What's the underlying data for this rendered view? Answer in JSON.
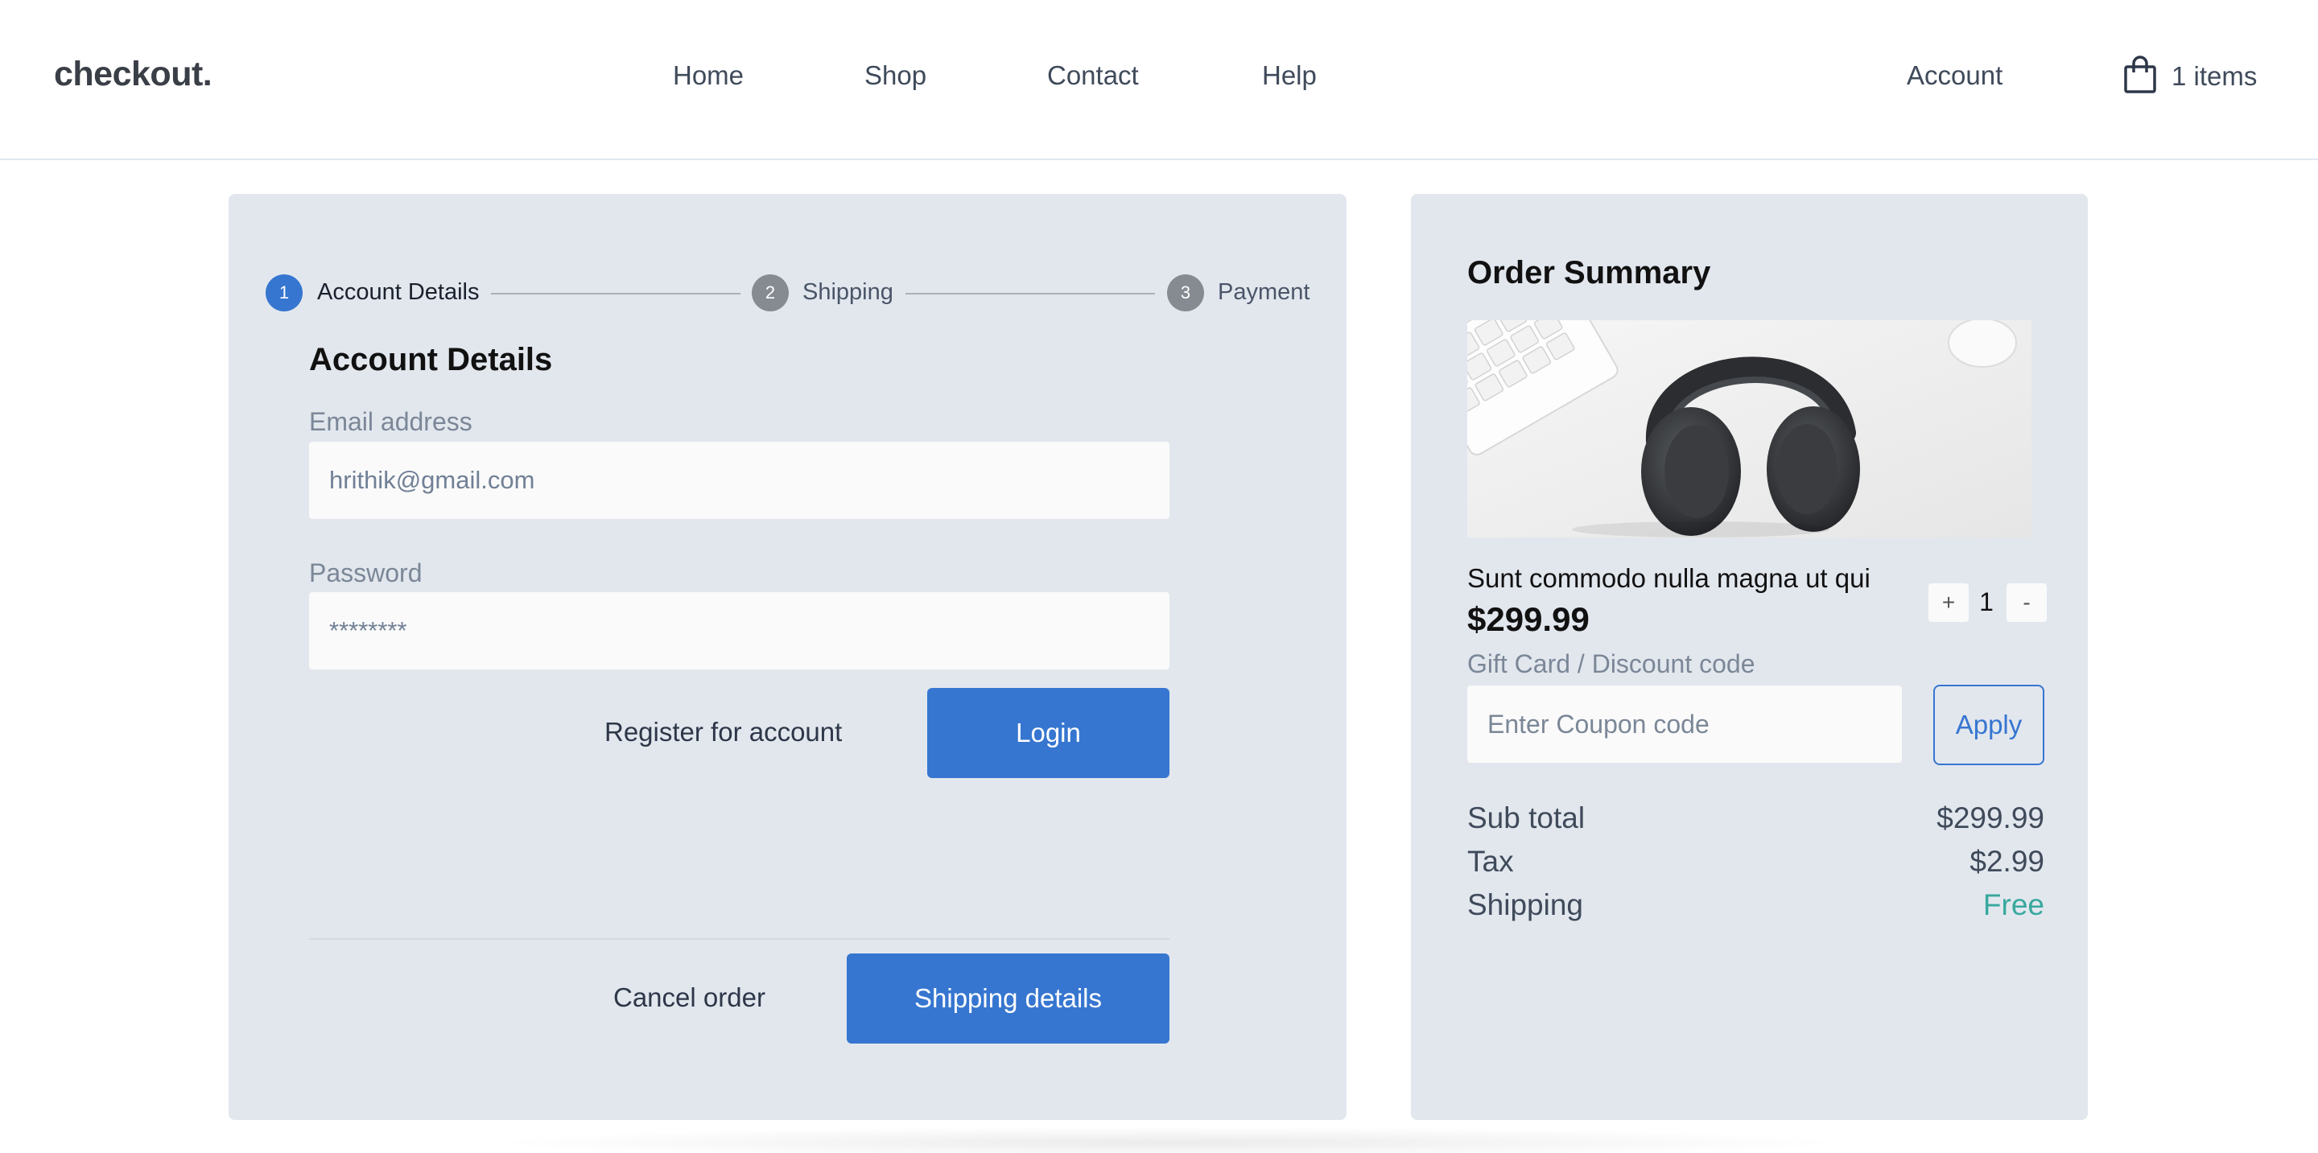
{
  "nav": {
    "brand": "checkout.",
    "links": [
      "Home",
      "Shop",
      "Contact",
      "Help"
    ],
    "account": "Account",
    "cart_label": "1 items"
  },
  "steps": [
    {
      "number": "1",
      "label": "Account Details",
      "state": "active"
    },
    {
      "number": "2",
      "label": "Shipping",
      "state": "inactive"
    },
    {
      "number": "3",
      "label": "Payment",
      "state": "inactive"
    }
  ],
  "account_form": {
    "title": "Account Details",
    "email_label": "Email address",
    "email_placeholder": "hrithik@gmail.com",
    "password_label": "Password",
    "password_placeholder": "********",
    "register_label": "Register for account",
    "login_label": "Login",
    "cancel_label": "Cancel order",
    "next_label": "Shipping details"
  },
  "summary": {
    "title": "Order Summary",
    "product_name": "Sunt commodo nulla magna ut qui",
    "product_price": "$299.99",
    "quantity": "1",
    "plus_label": "+",
    "minus_label": "-",
    "coupon_label": "Gift Card / Discount code",
    "coupon_placeholder": "Enter Coupon code",
    "apply_label": "Apply",
    "subtotal_label": "Sub total",
    "subtotal_value": "$299.99",
    "tax_label": "Tax",
    "tax_value": "$2.99",
    "shipping_label": "Shipping",
    "shipping_value": "Free"
  },
  "colors": {
    "accent": "#3676d0",
    "panel_bg": "#e2e7ee",
    "free_text": "#38a89d",
    "step_inactive": "#868b92"
  },
  "icons": {
    "cart": "shopping-bag-icon",
    "product": "headphones-product-image"
  }
}
